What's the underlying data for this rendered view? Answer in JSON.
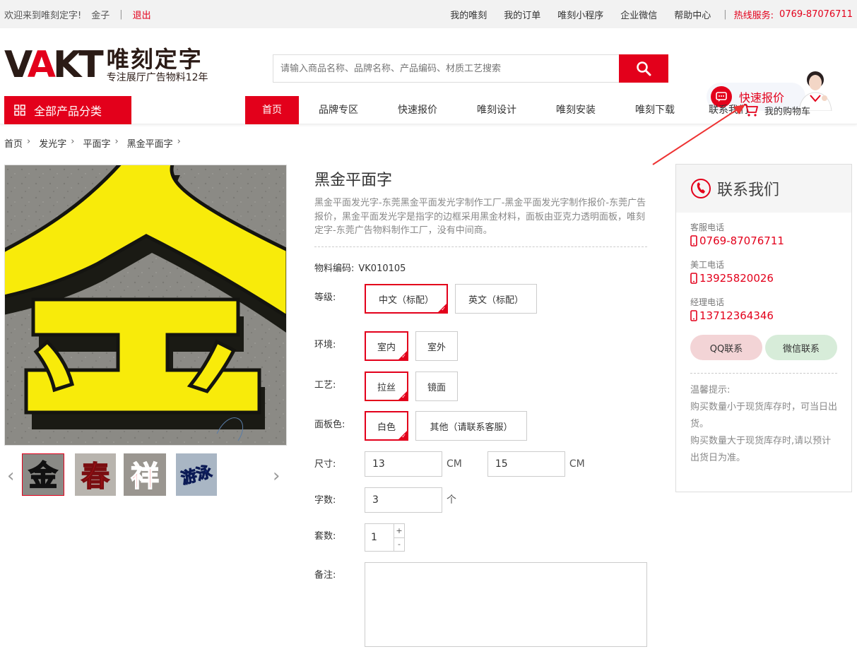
{
  "topbar": {
    "welcome": "欢迎来到唯刻定字!",
    "username": "金子",
    "separator": "|",
    "logout": "退出",
    "links": [
      "我的唯刻",
      "我的订单",
      "唯刻小程序",
      "企业微信",
      "帮助中心"
    ],
    "hotline_label": "热线服务:",
    "hotline_number": "0769-87076711"
  },
  "header": {
    "logo_mark_1": "V",
    "logo_mark_a": "A",
    "logo_mark_2": "KT",
    "brand_name": "唯刻定字",
    "slogan": "专注展厅广告物料12年",
    "search_placeholder": "请输入商品名称、品牌名称、产品编码、材质工艺搜索",
    "quick_quote": "快速报价"
  },
  "nav": {
    "all_categories": "全部产品分类",
    "items": [
      "首页",
      "品牌专区",
      "快速报价",
      "唯刻设计",
      "唯刻安装",
      "唯刻下载",
      "联系我们"
    ],
    "active_index": 0,
    "cart": "我的购物车"
  },
  "breadcrumb": [
    "首页",
    "发光字",
    "平面字",
    "黑金平面字"
  ],
  "gallery": {
    "main_char": "金",
    "thumbs": [
      {
        "char": "金",
        "color": "#f5d800",
        "bg": "#8a8a86"
      },
      {
        "char": "春",
        "color": "#e8161d",
        "bg": "#b8b4ae"
      },
      {
        "char": "祥",
        "color": "#e8161d",
        "bg": "#9a9690"
      },
      {
        "char": "游泳",
        "color": "#1f3fa8",
        "bg": "#a9b6c4"
      }
    ]
  },
  "product": {
    "title": "黑金平面字",
    "description": "黑金平面发光字-东莞黑金平面发光字制作工厂-黑金平面发光字制作报价-东莞广告报价，黑金平面发光字是指字的边框采用黑金材料，面板由亚克力透明面板，唯刻定字-东莞广告物料制作工厂，没有中间商。",
    "code_label": "物料编码:",
    "code_value": "VK010105",
    "options": {
      "grade": {
        "label": "等级:",
        "values": [
          "中文（标配）",
          "英文（标配）"
        ],
        "selected": 0
      },
      "env": {
        "label": "环境:",
        "values": [
          "室内",
          "室外"
        ],
        "selected": 0
      },
      "craft": {
        "label": "工艺:",
        "values": [
          "拉丝",
          "镜面"
        ],
        "selected": 0
      },
      "panel": {
        "label": "面板色:",
        "values": [
          "白色",
          "其他（请联系客服）"
        ],
        "selected": 0
      }
    },
    "size": {
      "label": "尺寸:",
      "width": "13",
      "height": "15",
      "unit": "CM"
    },
    "chars": {
      "label": "字数:",
      "value": "3",
      "unit": "个"
    },
    "sets": {
      "label": "套数:",
      "value": "1",
      "plus": "+",
      "minus": "-"
    },
    "remark": {
      "label": "备注:"
    }
  },
  "contact": {
    "title": "联系我们",
    "service_label": "客服电话",
    "service_phone": "0769-87076711",
    "design_label": "美工电话",
    "design_phone": "13925820026",
    "manager_label": "经理电话",
    "manager_phone": "13712364346",
    "qq_button": "QQ联系",
    "wechat_button": "微信联系",
    "tip_title": "温馨提示:",
    "tip_1": "购买数量小于现货库存时，可当日出货。",
    "tip_2": "购买数量大于现货库存时,请以预计出货日为准。"
  },
  "colors": {
    "brand_red": "#e3001b",
    "dark": "#2b1b16"
  },
  "icons": [
    "search-icon",
    "grid-icon",
    "cart-icon",
    "chat-icon",
    "phone-icon",
    "mobile-icon",
    "chevron-left-icon",
    "chevron-right-icon"
  ]
}
